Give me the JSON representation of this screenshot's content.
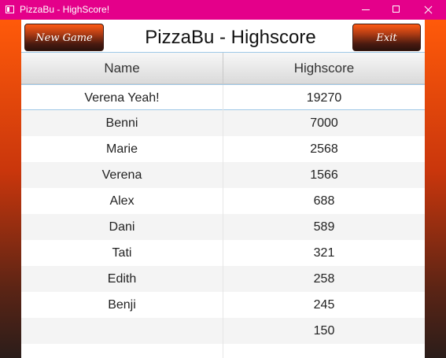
{
  "window": {
    "title": "PizzaBu - HighScore!"
  },
  "header": {
    "new_game_label": "New Game",
    "title": "PizzaBu - Highscore",
    "exit_label": "Exit"
  },
  "table": {
    "columns": [
      "Name",
      "Highscore"
    ],
    "rows": [
      {
        "name": "Verena Yeah!",
        "score": "19270"
      },
      {
        "name": "Benni",
        "score": "7000"
      },
      {
        "name": "Marie",
        "score": "2568"
      },
      {
        "name": "Verena",
        "score": "1566"
      },
      {
        "name": "Alex",
        "score": "688"
      },
      {
        "name": "Dani",
        "score": "589"
      },
      {
        "name": "Tati",
        "score": "321"
      },
      {
        "name": "Edith",
        "score": "258"
      },
      {
        "name": "Benji",
        "score": "245"
      },
      {
        "name": "",
        "score": "150"
      },
      {
        "name": "",
        "score": ""
      }
    ]
  },
  "colors": {
    "titlebar": "#e4008a",
    "accent": "#ff5a0a",
    "selection_line": "#9ec8e6"
  },
  "icons": {
    "app": "app-icon",
    "minimize": "minimize-icon",
    "maximize": "maximize-icon",
    "close": "close-icon"
  }
}
